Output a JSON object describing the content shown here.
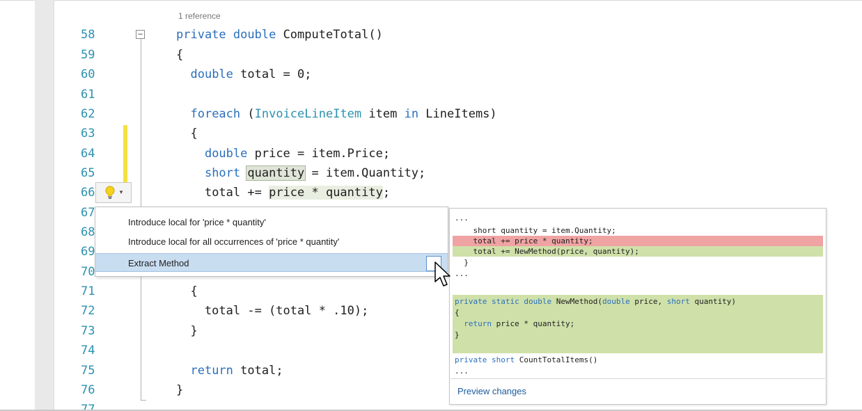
{
  "editor": {
    "codelens": "1 reference",
    "lines": [
      {
        "num": "58",
        "code": ""
      },
      {
        "num": "59",
        "code": "{"
      },
      {
        "num": "60",
        "code": ""
      },
      {
        "num": "61",
        "code": ""
      },
      {
        "num": "62",
        "code": ""
      },
      {
        "num": "63",
        "code": "  {"
      },
      {
        "num": "64",
        "code": ""
      },
      {
        "num": "65",
        "code": ""
      },
      {
        "num": "66",
        "code": ""
      },
      {
        "num": "67",
        "code": ""
      },
      {
        "num": "68",
        "code": ""
      },
      {
        "num": "69",
        "code": ""
      },
      {
        "num": "70",
        "code": ""
      },
      {
        "num": "71",
        "code": "  {"
      },
      {
        "num": "72",
        "code": "    total -= (total * .10);"
      },
      {
        "num": "73",
        "code": "  }"
      },
      {
        "num": "74",
        "code": ""
      },
      {
        "num": "75",
        "code": ""
      },
      {
        "num": "76",
        "code": "}"
      },
      {
        "num": "77",
        "code": ""
      }
    ],
    "tokens": {
      "private": "private",
      "double": "double",
      "method_sig": " ComputeTotal()",
      "l60_rest": " total = 0;",
      "foreach": "foreach",
      "open_paren": " (",
      "invoice_type": "InvoiceLineItem",
      "item": " item ",
      "in": "in",
      "line_items": " LineItems)",
      "l64_rest": " price = item.Price;",
      "short": "short",
      "quantity": "quantity",
      "l65_rest": " = item.Quantity;",
      "l66_pre": "total += ",
      "price_times_qty": "price * quantity",
      "semicolon": ";",
      "l70_partial": "(                )",
      "return": "return",
      "l75_rest": " total;"
    }
  },
  "lightbulb": {
    "icon": "lightbulb-icon",
    "chevron": "▾"
  },
  "quick_actions": {
    "items": [
      {
        "label": "Introduce local for 'price * quantity'"
      },
      {
        "label": "Introduce local for all occurrences of 'price * quantity'"
      },
      {
        "label": "Extract Method"
      }
    ]
  },
  "preview": {
    "line1": "...",
    "line2": "    short quantity = item.Quantity;",
    "line3_removed": "    total += price * quantity;",
    "line4_added": "    total += NewMethod(price, quantity);",
    "line5": "  }",
    "line6": "...",
    "method_private": "private",
    "method_static": "static",
    "method_double": "double",
    "method_name": " NewMethod(",
    "method_double2": "double",
    "method_price": " price, ",
    "method_short": "short",
    "method_qty": " quantity)",
    "brace_open": "{",
    "return_kw": "return",
    "return_rest": " price * quantity;",
    "brace_close": "}",
    "count_private": "private",
    "count_short": "short",
    "count_rest": " CountTotalItems()",
    "ellipsis": "...",
    "preview_link": "Preview changes"
  },
  "colors": {
    "keyword": "#2a6fbd",
    "type": "#2b91af",
    "line_number": "#2b91af",
    "removed": "#f0a3a3",
    "added": "#cfe0a9",
    "selection": "#c9ddf1"
  }
}
